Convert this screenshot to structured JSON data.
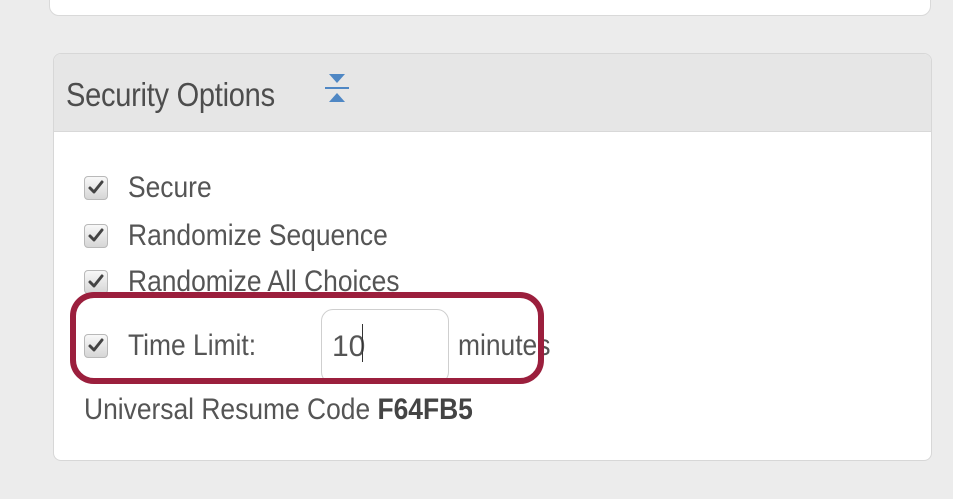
{
  "panel": {
    "title": "Security Options",
    "collapse_icon": "collapse-vertical-icon"
  },
  "options": [
    {
      "label": "Secure",
      "checked": true
    },
    {
      "label": "Randomize Sequence",
      "checked": true
    },
    {
      "label": "Randomize All Choices",
      "checked": true
    }
  ],
  "time_limit": {
    "label": "Time Limit:",
    "value": "10",
    "unit": "minutes",
    "checked": true
  },
  "resume": {
    "label": "Universal Resume Code",
    "code": "F64FB5"
  },
  "colors": {
    "highlight": "#9b1f3d",
    "icon_blue": "#4f87c4"
  }
}
